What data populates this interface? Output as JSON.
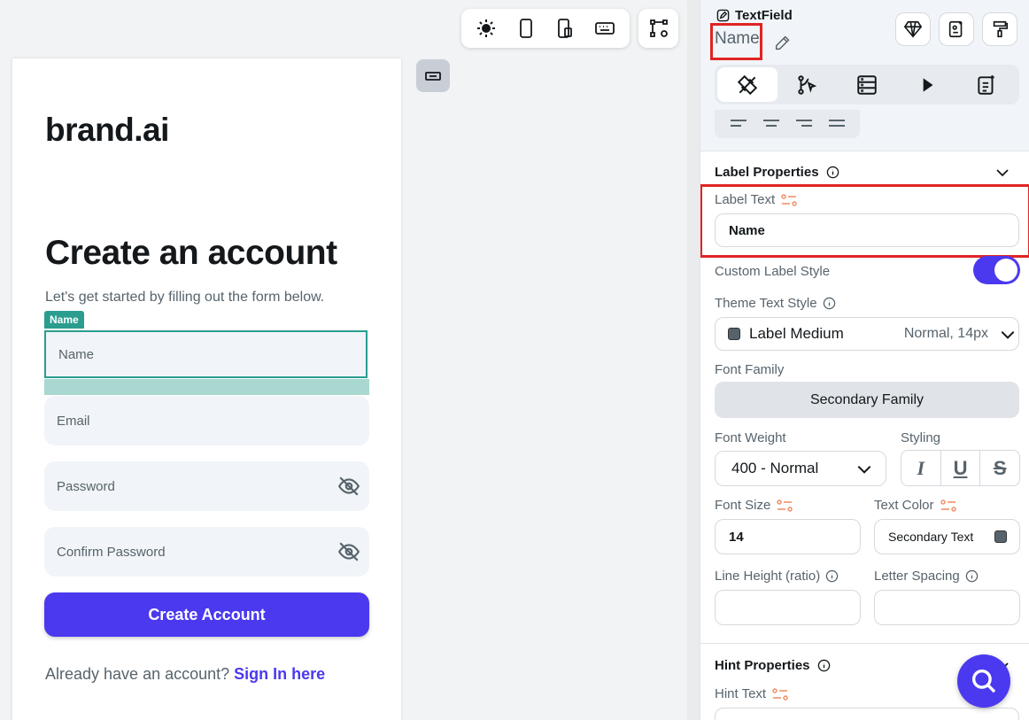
{
  "canvas": {
    "brand": "brand.ai",
    "headline": "Create an account",
    "subtitle": "Let's get started by filling out the form below.",
    "selected_tag": "Name",
    "fields": {
      "name": "Name",
      "email": "Email",
      "password": "Password",
      "confirm_password": "Confirm Password"
    },
    "create_button": "Create Account",
    "signin_prompt": "Already have an account?",
    "signin_link": "Sign In here"
  },
  "panel": {
    "component_type": "TextField",
    "component_name": "Name",
    "label_section": {
      "title": "Label Properties",
      "label_text_label": "Label Text",
      "label_text_value": "Name",
      "custom_style_label": "Custom Label Style",
      "custom_style_on": true,
      "theme_style_label": "Theme Text Style",
      "theme_style_value": "Label Medium",
      "theme_style_detail": "Normal, 14px",
      "font_family_label": "Font Family",
      "font_family_value": "Secondary Family",
      "font_weight_label": "Font Weight",
      "font_weight_value": "400 - Normal",
      "styling_label": "Styling",
      "styling_buttons": [
        "I",
        "U",
        "S"
      ],
      "font_size_label": "Font Size",
      "font_size_value": "14",
      "text_color_label": "Text Color",
      "text_color_value": "Secondary Text",
      "line_height_label": "Line Height (ratio)",
      "letter_spacing_label": "Letter Spacing"
    },
    "hint_section": {
      "title": "Hint Properties",
      "hint_text_label": "Hint Text"
    }
  },
  "colors": {
    "primary": "#4b39ef",
    "selection": "#2a9d8f",
    "highlight_red": "#e02424"
  }
}
